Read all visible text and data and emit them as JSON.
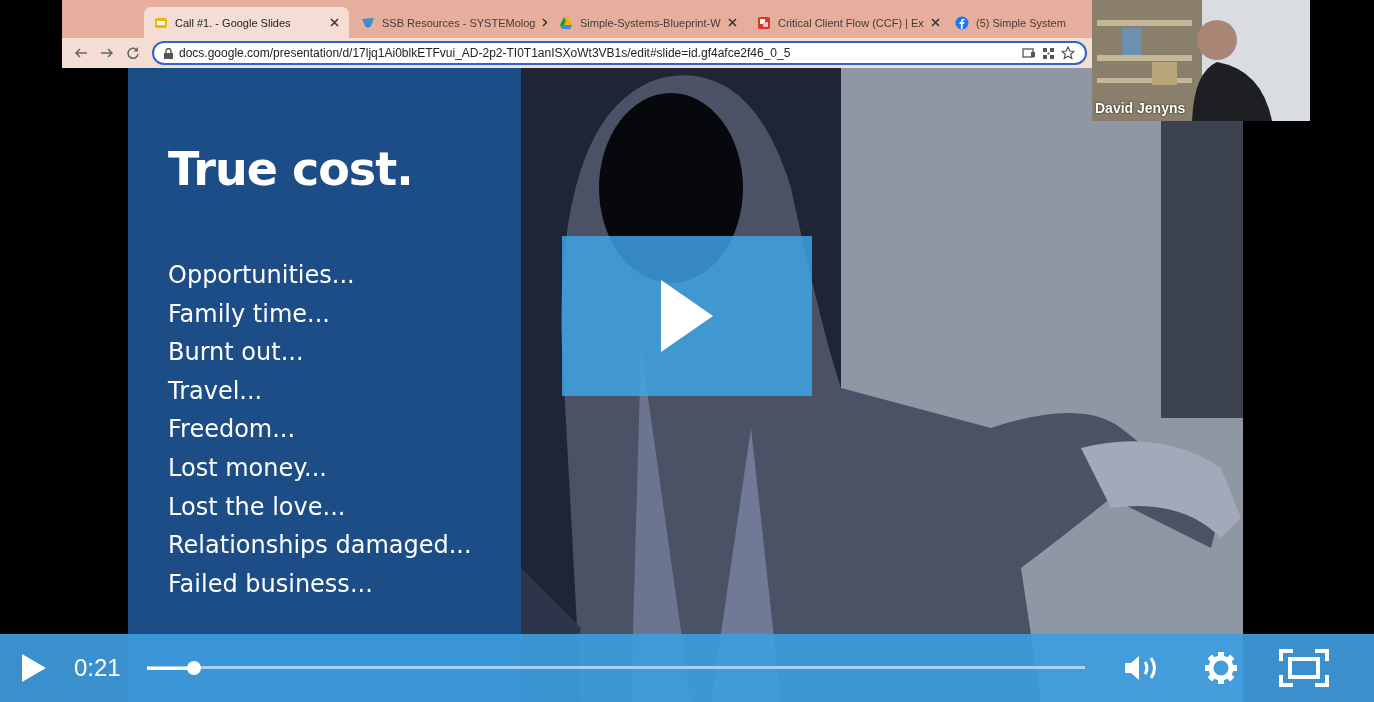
{
  "browser": {
    "tabs": [
      {
        "kind": "slides",
        "label": "Call #1. - Google Slides",
        "selected": true
      },
      {
        "kind": "bird",
        "label": "SSB Resources - SYSTEMolog",
        "selected": false
      },
      {
        "kind": "drive",
        "label": "Simple-Systems-Blueprint-W",
        "selected": false
      },
      {
        "kind": "square",
        "label": "Critical Client Flow (CCF) | Ex",
        "selected": false
      },
      {
        "kind": "facebook",
        "label": "(5) Simple System",
        "selected": false
      }
    ],
    "url": "docs.google.com/presentation/d/17ljq1Ai0blkETFvui_AD-2p2-TI0T1anISXoWt3VB1s/edit#slide=id.gf4afce2f46_0_5"
  },
  "slide": {
    "title": "True cost.",
    "items": [
      "Opportunities...",
      "Family time...",
      "Burnt out...",
      "Travel...",
      "Freedom...",
      "Lost money...",
      "Lost the love...",
      "Relationships damaged...",
      "Failed business..."
    ]
  },
  "participant": {
    "kind": "picture",
    "name": "David Jenyns"
  },
  "player": {
    "paused": true,
    "time": "0:21",
    "progress": {
      "level": 0.05
    }
  }
}
